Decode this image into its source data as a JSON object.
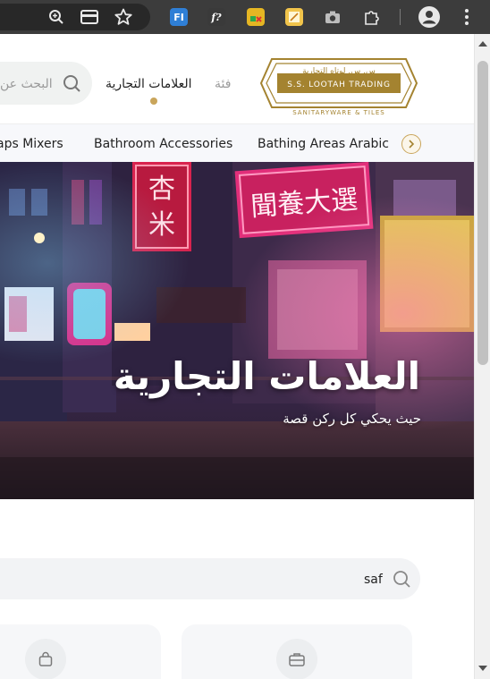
{
  "browser": {
    "toolbar_icons": [
      "zoom-icon",
      "card-icon",
      "star-icon"
    ],
    "extensions": [
      {
        "name": "fi-extension-icon",
        "label": "FI",
        "color": "#2f7fd6"
      },
      {
        "name": "formula-extension-icon",
        "label": "f?",
        "color": "#3a3a3a"
      },
      {
        "name": "calendar-extension-icon",
        "label": "",
        "color": "#e5b623"
      },
      {
        "name": "note-extension-icon",
        "label": "",
        "color": "#f1c44b"
      },
      {
        "name": "camera-extension-icon",
        "label": "",
        "color": "#8a8a8a"
      },
      {
        "name": "puzzle-extension-icon",
        "label": "",
        "color": "#cfcfcf"
      }
    ]
  },
  "header": {
    "logo_arabic": "س. س. لوتاه التجارية",
    "logo_english": "S.S. LOOTAH TRADING",
    "logo_tagline": "SANITARYWARE & TILES",
    "nav": {
      "category": "فئة",
      "brands": "العلامات التجارية"
    },
    "search_placeholder": "البحث عن"
  },
  "categories": {
    "items": [
      "aps Mixers",
      "Bathroom Accessories",
      "Bathing Areas Arabic"
    ]
  },
  "hero": {
    "title": "العلامات التجارية",
    "subtitle": "حيث يحكي كل ركن قصة"
  },
  "brand_search": {
    "value": "saf"
  },
  "colors": {
    "accent_gold": "#c9a55b",
    "toolbar_bg": "#3c3c3c"
  }
}
